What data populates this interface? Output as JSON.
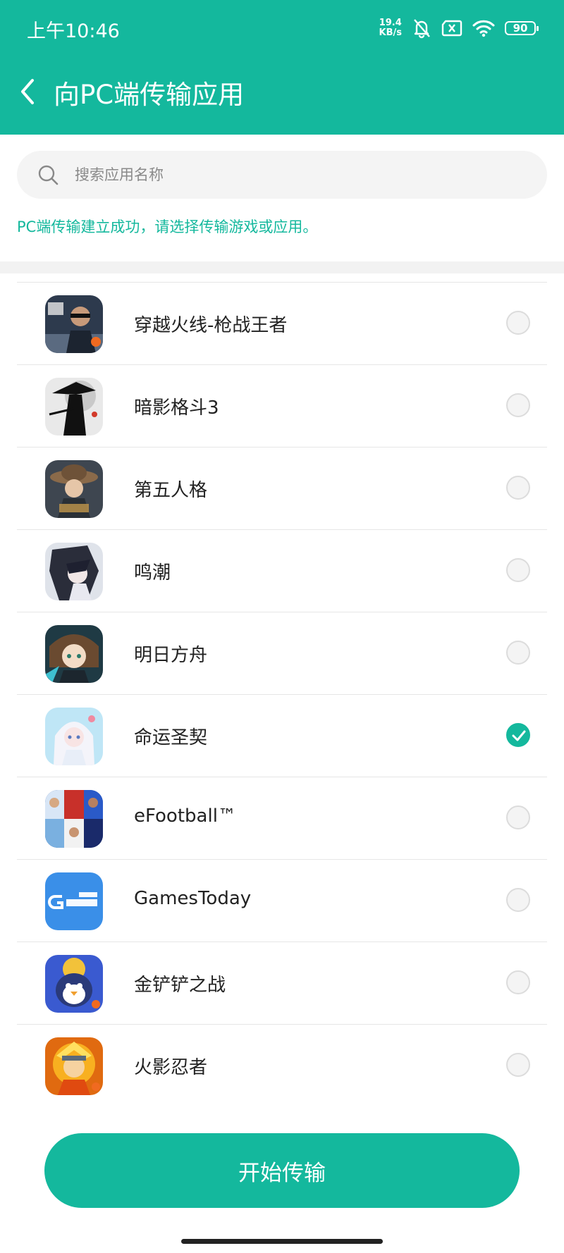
{
  "status_bar": {
    "time": "上午10:46",
    "net_speed_value": "19.4",
    "net_speed_unit": "KB/s",
    "battery": "90",
    "icons": [
      "mute-bell-icon",
      "no-sim-icon",
      "wifi-icon",
      "battery-icon"
    ]
  },
  "header": {
    "title": "向PC端传输应用",
    "back_icon": "chevron-left-icon"
  },
  "search": {
    "placeholder": "搜索应用名称",
    "value": ""
  },
  "hint": "PC端传输建立成功，请选择传输游戏或应用。",
  "apps": [
    {
      "name": "穿越火线-枪战王者",
      "checked": false
    },
    {
      "name": "暗影格斗3",
      "checked": false
    },
    {
      "name": "第五人格",
      "checked": false
    },
    {
      "name": "鸣潮",
      "checked": false
    },
    {
      "name": "明日方舟",
      "checked": false
    },
    {
      "name": "命运圣契",
      "checked": true
    },
    {
      "name": "eFootball™",
      "checked": false
    },
    {
      "name": "GamesToday",
      "checked": false
    },
    {
      "name": "金铲铲之战",
      "checked": false
    },
    {
      "name": "火影忍者",
      "checked": false
    }
  ],
  "start_button": "开始传输",
  "colors": {
    "accent": "#14b89d",
    "text": "#222222"
  }
}
